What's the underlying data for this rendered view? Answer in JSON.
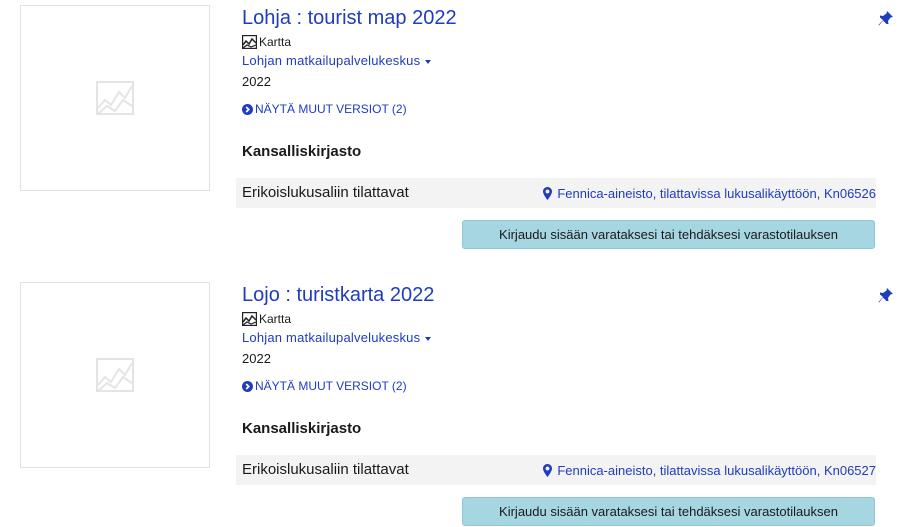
{
  "results": [
    {
      "title": "Lohja : tourist map 2022",
      "format": "Kartta",
      "author": "Lohjan matkailupalvelukeskus",
      "year": "2022",
      "versions_label": "NÄYTÄ MUUT VERSIOT (2)",
      "library": "Kansalliskirjasto",
      "holding_status": "Erikoislukusaliin tilattavat",
      "holding_location": "Fennica-aineisto, tilattavissa lukusalikäyttöön, Kn06526",
      "login_button": "Kirjaudu sisään varataksesi tai tehdäksesi varastotilauksen"
    },
    {
      "title": "Lojo : turistkarta 2022",
      "format": "Kartta",
      "author": "Lohjan matkailupalvelukeskus",
      "year": "2022",
      "versions_label": "NÄYTÄ MUUT VERSIOT (2)",
      "library": "Kansalliskirjasto",
      "holding_status": "Erikoislukusaliin tilattavat",
      "holding_location": "Fennica-aineisto, tilattavissa lukusalikäyttöön, Kn06527",
      "login_button": "Kirjaudu sisään varataksesi tai tehdäksesi varastotilauksen"
    }
  ],
  "icons": {
    "thumbnail": "map-placeholder-icon",
    "format": "map-icon",
    "pin": "pushpin-icon",
    "versions": "circle-chevron-right-icon",
    "location": "map-marker-icon",
    "author_menu": "caret-down-icon"
  },
  "colors": {
    "link": "#1f3cbf",
    "button_bg": "#a6d6e2",
    "row_bg": "#f3f3f3"
  }
}
